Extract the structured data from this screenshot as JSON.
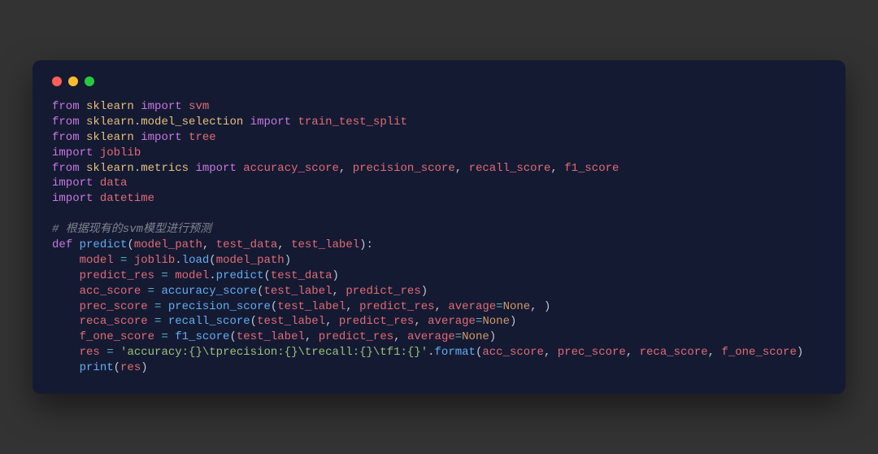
{
  "window": {
    "dots": [
      "red",
      "yellow",
      "green"
    ]
  },
  "code": {
    "l1": {
      "kw1": "from",
      "mod": "sklearn",
      "kw2": "import",
      "tgt": "svm"
    },
    "l2": {
      "kw1": "from",
      "mod1": "sklearn",
      "dot": ".",
      "mod2": "model_selection",
      "kw2": "import",
      "tgt": "train_test_split"
    },
    "l3": {
      "kw1": "from",
      "mod": "sklearn",
      "kw2": "import",
      "tgt": "tree"
    },
    "l4": {
      "kw1": "import",
      "tgt": "joblib"
    },
    "l5": {
      "kw1": "from",
      "mod1": "sklearn",
      "dot": ".",
      "mod2": "metrics",
      "kw2": "import",
      "t1": "accuracy_score",
      "c": ", ",
      "t2": "precision_score",
      "t3": "recall_score",
      "t4": "f1_score"
    },
    "l6": {
      "kw1": "import",
      "tgt": "data"
    },
    "l7": {
      "kw1": "import",
      "tgt": "datetime"
    },
    "l8": {
      "cmt": "# 根据现有的svm模型进行预测"
    },
    "l9": {
      "kw": "def",
      "name": "predict",
      "op": "(",
      "p1": "model_path",
      "c": ", ",
      "p2": "test_data",
      "p3": "test_label",
      "cp": "):"
    },
    "l10": {
      "indent": "    ",
      "lhs": "model",
      "eq": " = ",
      "obj": "joblib",
      "dot": ".",
      "call": "load",
      "op": "(",
      "arg": "model_path",
      "cp": ")"
    },
    "l11": {
      "indent": "    ",
      "lhs": "predict_res",
      "eq": " = ",
      "obj": "model",
      "dot": ".",
      "call": "predict",
      "op": "(",
      "arg": "test_data",
      "cp": ")"
    },
    "l12": {
      "indent": "    ",
      "lhs": "acc_score",
      "eq": " = ",
      "call": "accuracy_score",
      "op": "(",
      "a1": "test_label",
      "c": ", ",
      "a2": "predict_res",
      "cp": ")"
    },
    "l13": {
      "indent": "    ",
      "lhs": "prec_score",
      "eq": " = ",
      "call": "precision_score",
      "op": "(",
      "a1": "test_label",
      "c": ", ",
      "a2": "predict_res",
      "kw": "average",
      "eqs": "=",
      "val": "None",
      "tail": ", )"
    },
    "l14": {
      "indent": "    ",
      "lhs": "reca_score",
      "eq": " = ",
      "call": "recall_score",
      "op": "(",
      "a1": "test_label",
      "c": ", ",
      "a2": "predict_res",
      "kw": "average",
      "eqs": "=",
      "val": "None",
      "cp": ")"
    },
    "l15": {
      "indent": "    ",
      "lhs": "f_one_score",
      "eq": " = ",
      "call": "f1_score",
      "op": "(",
      "a1": "test_label",
      "c": ", ",
      "a2": "predict_res",
      "kw": "average",
      "eqs": "=",
      "val": "None",
      "cp": ")"
    },
    "l16": {
      "indent": "    ",
      "lhs": "res",
      "eq": " = ",
      "str": "'accuracy:{}\\tprecision:{}\\trecall:{}\\tf1:{}'",
      "dot": ".",
      "call": "format",
      "op": "(",
      "a1": "acc_score",
      "c": ", ",
      "a2": "prec_score",
      "a3": "reca_score",
      "a4": "f_one_score",
      "cp": ")"
    },
    "l17": {
      "indent": "    ",
      "call": "print",
      "op": "(",
      "arg": "res",
      "cp": ")"
    }
  }
}
